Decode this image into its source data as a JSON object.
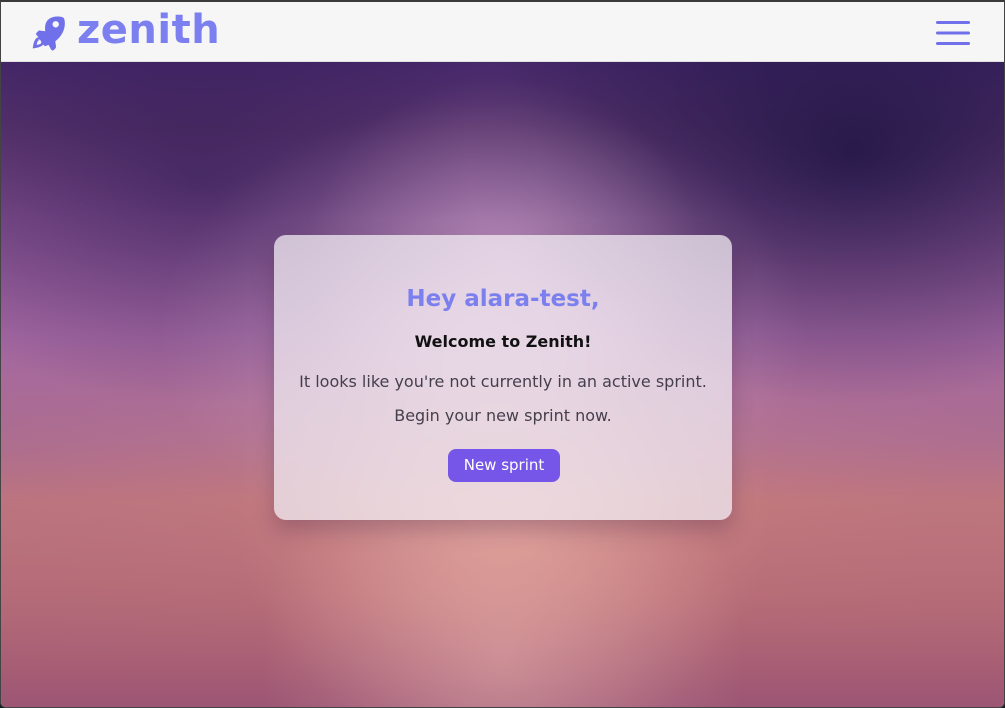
{
  "header": {
    "brand": "zenith",
    "brand_icon": "rocket-icon",
    "menu_icon": "hamburger-menu-icon",
    "brand_color": "#7b7ff0"
  },
  "hero": {
    "greeting": "Hey alara-test,",
    "welcome": "Welcome to Zenith!",
    "message": "It looks like you're not currently in an active sprint.",
    "prompt": "Begin your new sprint now.",
    "button_label": "New sprint",
    "button_color": "#7656e8"
  }
}
